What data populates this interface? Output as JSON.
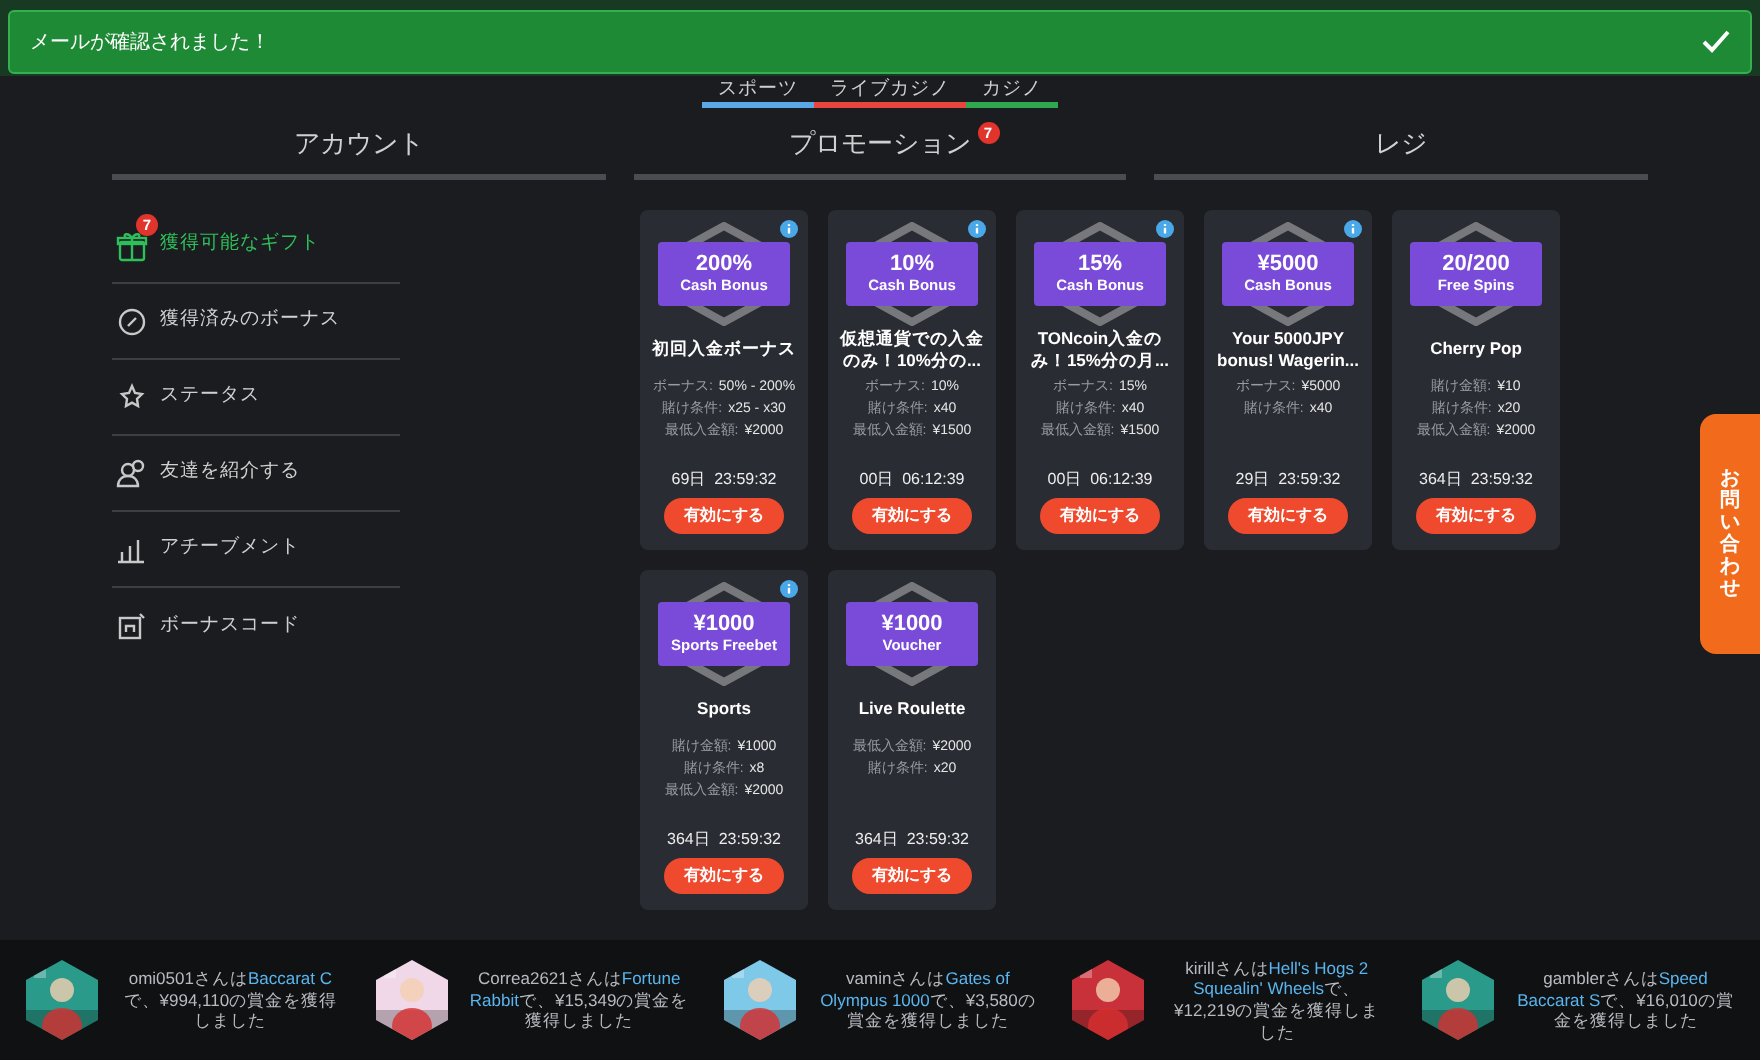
{
  "notification": {
    "message": "メールが確認されました！"
  },
  "sub_tabs": [
    {
      "label": "スポーツ",
      "color": "#5aa9e6"
    },
    {
      "label": "ライブカジノ",
      "color": "#e8453c"
    },
    {
      "label": "カジノ",
      "color": "#2fa84f"
    }
  ],
  "main_tabs": [
    {
      "label": "アカウント"
    },
    {
      "label": "プロモーション",
      "badge": "7"
    },
    {
      "label": "レジ"
    }
  ],
  "sidebar": {
    "items": [
      {
        "label": "獲得可能なギフト",
        "selected": true,
        "badge": "7"
      },
      {
        "label": "獲得済みのボーナス",
        "selected": false
      },
      {
        "label": "ステータス",
        "selected": false
      },
      {
        "label": "友達を紹介する",
        "selected": false
      },
      {
        "label": "アチーブメント",
        "selected": false
      },
      {
        "label": "ボーナスコード",
        "selected": false
      }
    ]
  },
  "cards": [
    {
      "amount": "200%",
      "type": "Cash Bonus",
      "title": "初回入金ボーナス",
      "info": true,
      "details": [
        [
          "ボーナス:",
          "50% - 200%"
        ],
        [
          "賭け条件:",
          "x25 - x30"
        ],
        [
          "最低入金額:",
          "¥2000"
        ]
      ],
      "timer": "69日  23:59:32",
      "button": "有効にする"
    },
    {
      "amount": "10%",
      "type": "Cash Bonus",
      "title": "仮想通貨での入金のみ！10%分の...",
      "info": true,
      "details": [
        [
          "ボーナス:",
          "10%"
        ],
        [
          "賭け条件:",
          "x40"
        ],
        [
          "最低入金額:",
          "¥1500"
        ]
      ],
      "timer": "00日  06:12:39",
      "button": "有効にする"
    },
    {
      "amount": "15%",
      "type": "Cash Bonus",
      "title": "TONcoin入金のみ！15%分の月...",
      "info": true,
      "details": [
        [
          "ボーナス:",
          "15%"
        ],
        [
          "賭け条件:",
          "x40"
        ],
        [
          "最低入金額:",
          "¥1500"
        ]
      ],
      "timer": "00日  06:12:39",
      "button": "有効にする"
    },
    {
      "amount": "¥5000",
      "type": "Cash Bonus",
      "title": "Your 5000JPY bonus! Wagerin...",
      "info": true,
      "details": [
        [
          "ボーナス:",
          "¥5000"
        ],
        [
          "賭け条件:",
          "x40"
        ]
      ],
      "timer": "29日  23:59:32",
      "button": "有効にする"
    },
    {
      "amount": "20/200",
      "type": "Free Spins",
      "title": "Cherry Pop",
      "info": false,
      "details": [
        [
          "賭け金額:",
          "¥10"
        ],
        [
          "賭け条件:",
          "x20"
        ],
        [
          "最低入金額:",
          "¥2000"
        ]
      ],
      "timer": "364日  23:59:32",
      "button": "有効にする"
    },
    {
      "amount": "¥1000",
      "type": "Sports Freebet",
      "title": "Sports",
      "info": true,
      "details": [
        [
          "賭け金額:",
          "¥1000"
        ],
        [
          "賭け条件:",
          "x8"
        ],
        [
          "最低入金額:",
          "¥2000"
        ]
      ],
      "timer": "364日  23:59:32",
      "button": "有効にする"
    },
    {
      "amount": "¥1000",
      "type": "Voucher",
      "title": "Live Roulette",
      "info": false,
      "details": [
        [
          "最低入金額:",
          "¥2000"
        ],
        [
          "賭け条件:",
          "x20"
        ]
      ],
      "timer": "364日  23:59:32",
      "button": "有効にする"
    }
  ],
  "contact_tab": {
    "label": "お問い合わせ"
  },
  "ticker": [
    {
      "user": "omi0501さんは",
      "game": "Baccarat C",
      "rest": "で、¥994,110の賞金を獲得しました"
    },
    {
      "user": "Correa2621さんは",
      "game": "Fortune Rabbit",
      "rest": "で、¥15,349の賞金を獲得しました"
    },
    {
      "user": "vaminさんは",
      "game": "Gates of Olympus 1000",
      "rest": "で、¥3,580の賞金を獲得しました"
    },
    {
      "user": "kirillさんは",
      "game": "Hell's Hogs 2 Squealin' Wheels",
      "rest": "で、¥12,219の賞金を獲得しました"
    },
    {
      "user": "gamblerさんは",
      "game": "Speed Baccarat S",
      "rest": "で、¥16,010の賞金を獲得しました"
    }
  ]
}
